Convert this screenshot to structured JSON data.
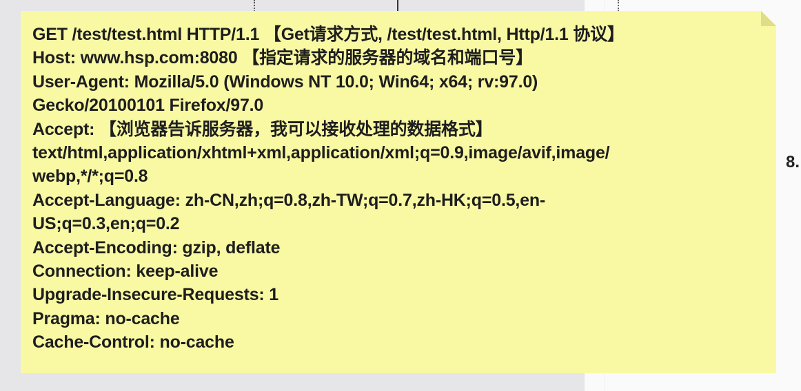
{
  "note": {
    "lines": [
      "GET /test/test.html HTTP/1.1 【Get请求方式, /test/test.html, Http/1.1 协议】",
      "Host: www.hsp.com:8080 【指定请求的服务器的域名和端口号】",
      "User-Agent: Mozilla/5.0 (Windows NT 10.0; Win64; x64; rv:97.0)",
      "Gecko/20100101 Firefox/97.0",
      "Accept: 【浏览器告诉服务器，我可以接收处理的数据格式】",
      "text/html,application/xhtml+xml,application/xml;q=0.9,image/avif,image/",
      "webp,*/*;q=0.8",
      "Accept-Language: zh-CN,zh;q=0.8,zh-TW;q=0.7,zh-HK;q=0.5,en-",
      "US;q=0.3,en;q=0.2",
      "Accept-Encoding: gzip, deflate",
      "Connection: keep-alive",
      "Upgrade-Insecure-Requests: 1",
      "Pragma: no-cache",
      "Cache-Control: no-cache"
    ]
  },
  "side_label": "8.",
  "colors": {
    "note_background": "#f9f9a4",
    "text": "#1e1e1e"
  }
}
